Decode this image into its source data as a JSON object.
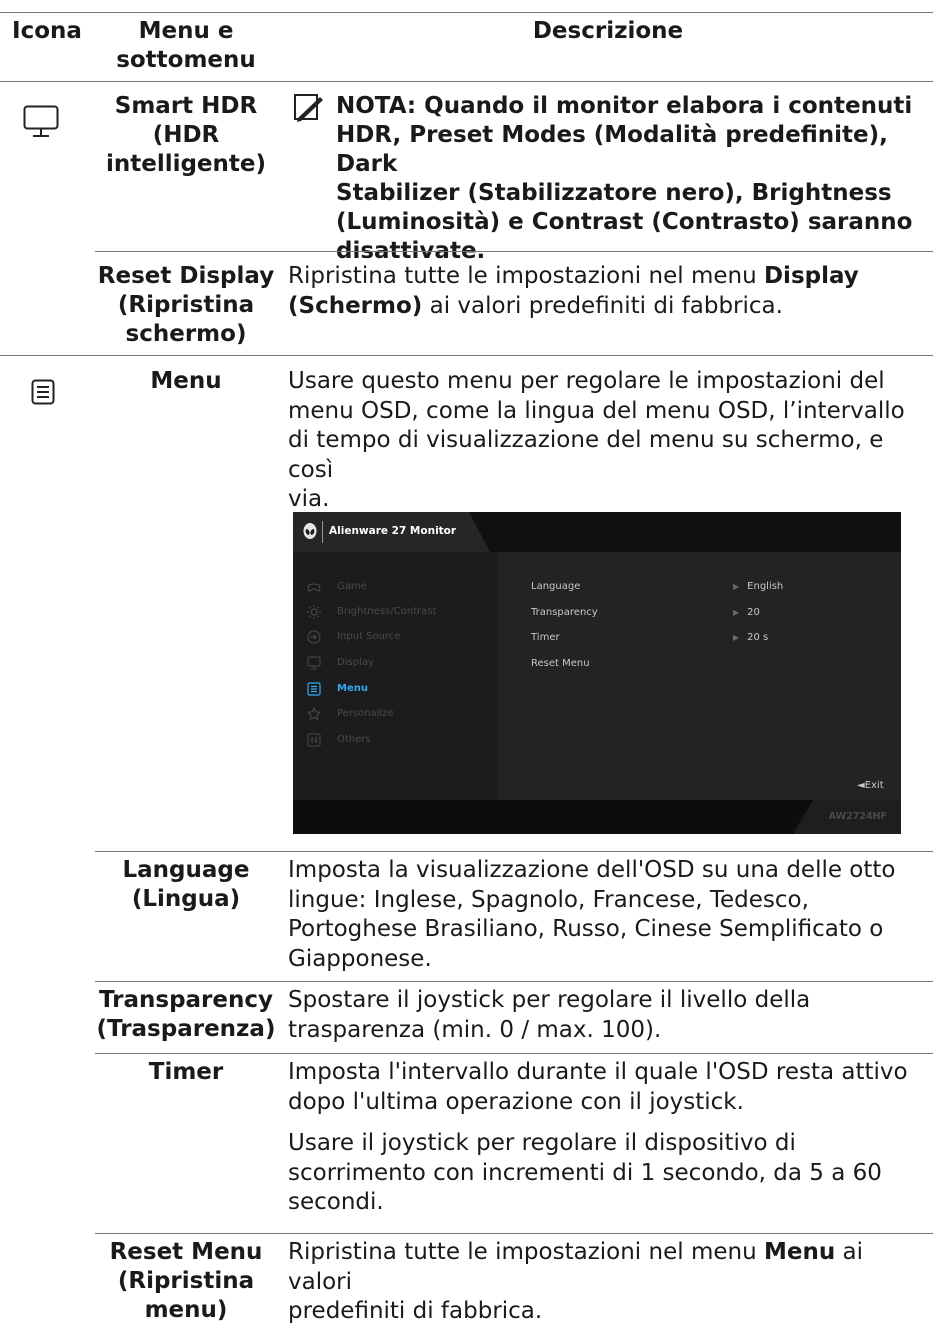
{
  "header": {
    "col_icon": "Icona",
    "col_menu_line1": "Menu e",
    "col_menu_line2": "sottomenu",
    "col_desc": "Descrizione"
  },
  "rows": {
    "smart_hdr": {
      "name_l1": "Smart HDR",
      "name_l2": "(HDR",
      "name_l3": "intelligente)",
      "note_l1": "NOTA: Quando il monitor elabora i contenuti",
      "note_l2": "HDR, Preset Modes (Modalità predefinite), Dark",
      "note_l3": "Stabilizer (Stabilizzatore nero), Brightness",
      "note_l4": "(Luminosità) e Contrast (Contrasto) saranno",
      "note_l5": "disattivate."
    },
    "reset_display": {
      "name_l1": "Reset Display",
      "name_l2": "(Ripristina",
      "name_l3": "schermo)",
      "d1a": "Ripristina tutte le impostazioni nel menu ",
      "d1b": "Display",
      "d2a": "(Schermo)",
      "d2b": " ai valori predefiniti di fabbrica."
    },
    "menu": {
      "name": "Menu",
      "d1": "Usare questo menu per regolare le impostazioni del",
      "d2": "menu OSD, come la lingua del menu OSD, l’intervallo",
      "d3": "di tempo di visualizzazione del menu su schermo, e così",
      "d4": "via."
    },
    "language": {
      "name_l1": "Language",
      "name_l2": "(Lingua)",
      "d1": "Imposta la visualizzazione dell'OSD su una delle otto",
      "d2": "lingue: Inglese, Spagnolo, Francese, Tedesco,",
      "d3": "Portoghese Brasiliano, Russo, Cinese Semplificato o",
      "d4": "Giapponese."
    },
    "transparency": {
      "name_l1": "Transparency",
      "name_l2": "(Trasparenza)",
      "d1": "Spostare il joystick per regolare il livello della",
      "d2": "trasparenza (min. 0 / max. 100)."
    },
    "timer": {
      "name": "Timer",
      "d1": "Imposta l'intervallo durante il quale l'OSD resta attivo",
      "d2": "dopo l'ultima operazione con il joystick.",
      "d3": "Usare il joystick per regolare il dispositivo di",
      "d4": "scorrimento con incrementi di 1 secondo, da 5 a 60",
      "d5": "secondi."
    },
    "reset_menu": {
      "name_l1": "Reset Menu",
      "name_l2": "(Ripristina",
      "name_l3": "menu)",
      "d1a": "Ripristina tutte le impostazioni nel menu ",
      "d1b": "Menu",
      "d1c": " ai valori",
      "d2": "predefiniti di fabbrica."
    }
  },
  "osd": {
    "title": "Alienware 27 Monitor",
    "menu_items": [
      "Game",
      "Brightness/Contrast",
      "Input Source",
      "Display",
      "Menu",
      "Personalize",
      "Others"
    ],
    "active_item": "Menu",
    "options": [
      "Language",
      "Transparency",
      "Timer",
      "Reset Menu"
    ],
    "values": [
      "English",
      "20",
      "20 s"
    ],
    "exit": "◄Exit",
    "model": "AW2724HF",
    "accent_color": "#32a8f0"
  },
  "icons": {
    "display": "monitor-icon",
    "menu": "menu-list-icon",
    "note": "pencil-note-icon"
  }
}
